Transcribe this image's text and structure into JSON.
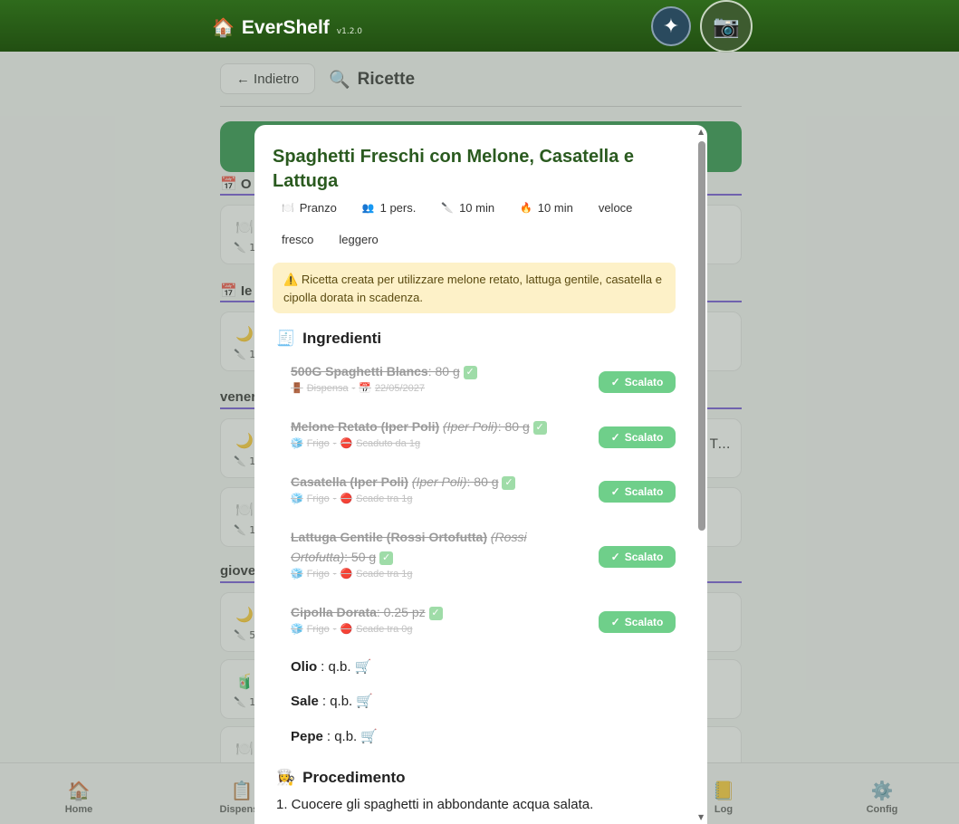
{
  "header": {
    "app_name": "EverShelf",
    "version": "v1.2.0",
    "logo_icon": "house-icon",
    "buttons": [
      {
        "name": "ai-sparkle",
        "glyph": "✦"
      },
      {
        "name": "camera",
        "glyph": "📷"
      }
    ]
  },
  "page": {
    "back_label": "← Indietro",
    "title": "Ricette",
    "title_icon": "🔍",
    "sections": [
      {
        "label": "Oggi",
        "visible": "O"
      },
      {
        "label": "Ieri",
        "visible": "Ie"
      },
      {
        "label": "venerdì",
        "visible": "vener"
      },
      {
        "label": "giovedì",
        "visible": "giove"
      }
    ],
    "partial_text": "T…"
  },
  "modal": {
    "title": "Spaghetti Freschi con Melone, Casatella e Lattuga",
    "tags": [
      {
        "icon": "🍽️",
        "label": "Pranzo"
      },
      {
        "icon": "👥",
        "label": "1 pers."
      },
      {
        "icon": "🔪",
        "label": "10 min"
      },
      {
        "icon": "🔥",
        "label": "10 min"
      },
      {
        "icon": "",
        "label": "veloce"
      },
      {
        "icon": "",
        "label": "fresco"
      },
      {
        "icon": "",
        "label": "leggero"
      }
    ],
    "note_icon": "⚠️",
    "note": "Ricetta creata per utilizzare melone retato, lattuga gentile, casatella e cipolla dorata in scadenza.",
    "ingredients_title": "Ingredienti",
    "ingredients_icon": "🧾",
    "ingredients": [
      {
        "name": "500G Spaghetti Blancs",
        "brand": "",
        "qty": ": 80 g",
        "loc_icon": "🚪",
        "location": "Dispensa",
        "exp_icon": "📅",
        "expiry": "22/05/2027",
        "badge": "Scalato"
      },
      {
        "name": "Melone Retato (Iper Poli)",
        "brand": "(Iper Poli)",
        "qty": ": 80 g",
        "loc_icon": "🧊",
        "location": "Frigo",
        "exp_icon": "⛔",
        "expiry": "Scaduto da 1g",
        "badge": "Scalato"
      },
      {
        "name": "Casatella (Iper Poli)",
        "brand": "(Iper Poli)",
        "qty": ": 80 g",
        "loc_icon": "🧊",
        "location": "Frigo",
        "exp_icon": "🔴",
        "expiry": "Scade tra 1g",
        "badge": "Scalato"
      },
      {
        "name": "Lattuga Gentile (Rossi Ortofutta)",
        "brand": "(Rossi Ortofutta)",
        "qty": ": 50 g",
        "loc_icon": "🧊",
        "location": "Frigo",
        "exp_icon": "🔴",
        "expiry": "Scade tra 1g",
        "badge": "Scalato"
      },
      {
        "name": "Cipolla Dorata",
        "brand": "",
        "qty": ": 0.25 pz",
        "loc_icon": "🧊",
        "location": "Frigo",
        "exp_icon": "🔴",
        "expiry": "Scade tra 0g",
        "badge": "Scalato"
      }
    ],
    "basics": [
      {
        "name": "Olio",
        "qty": ": q.b."
      },
      {
        "name": "Sale",
        "qty": ": q.b."
      },
      {
        "name": "Pepe",
        "qty": ": q.b."
      }
    ],
    "procedure_title": "Procedimento",
    "procedure_icon": "👩‍🍳",
    "steps": [
      "1. Cuocere gli spaghetti in abbondante acqua salata."
    ]
  },
  "bottom_nav": [
    {
      "label": "Home",
      "icon": "🏠"
    },
    {
      "label": "Dispensa",
      "icon": "📋"
    },
    {
      "label": "Log",
      "icon": "📒"
    },
    {
      "label": "Config",
      "icon": "⚙️"
    }
  ]
}
